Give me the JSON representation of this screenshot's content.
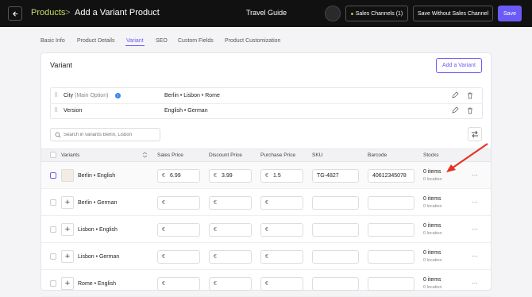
{
  "header": {
    "breadcrumb_root": "Products",
    "breadcrumb_sep": ">",
    "page_title": "Add a Variant Product",
    "store_name": "Travel Guide",
    "sales_channels_label": "Sales Channels (1)",
    "save_without_label": "Save Without Sales Channel",
    "save_label": "Save"
  },
  "tabs": [
    "Basic Info",
    "Product Details",
    "Variant",
    "SEO",
    "Custom Fields",
    "Product Customization"
  ],
  "variant_card": {
    "title": "Variant",
    "add_button": "Add a Variant",
    "options": [
      {
        "name": "City",
        "main": "(Main Option)",
        "values": "Berlin  •  Lisbon  •  Rome"
      },
      {
        "name": "Version",
        "main": "",
        "values": "English  •  German"
      }
    ],
    "search_placeholder": "Search in variants Berlin, Lisbon"
  },
  "table": {
    "columns": [
      "Variants",
      "Sales Price",
      "Discount Price",
      "Purchase Price",
      "SKU",
      "Barcode",
      "Stocks"
    ],
    "currency": "€",
    "rows": [
      {
        "name": "Berlin  •  English",
        "sales": "6.99",
        "discount": "3.99",
        "purchase": "1.5",
        "sku": "TG-4827",
        "barcode": "40612345078",
        "stock": "0 items",
        "location": "0 location"
      },
      {
        "name": "Berlin  •  German",
        "sales": "",
        "discount": "",
        "purchase": "",
        "sku": "",
        "barcode": "",
        "stock": "0 items",
        "location": "0 location"
      },
      {
        "name": "Lisbon  •  English",
        "sales": "",
        "discount": "",
        "purchase": "",
        "sku": "",
        "barcode": "",
        "stock": "0 items",
        "location": "0 location"
      },
      {
        "name": "Lisbon  •  German",
        "sales": "",
        "discount": "",
        "purchase": "",
        "sku": "",
        "barcode": "",
        "stock": "0 items",
        "location": "0 location"
      },
      {
        "name": "Rome  •  English",
        "sales": "",
        "discount": "",
        "purchase": "",
        "sku": "",
        "barcode": "",
        "stock": "0 items",
        "location": "0 location"
      }
    ],
    "more_label": "···"
  },
  "colors": {
    "accent": "#6b5bf6",
    "arrow": "#e53223",
    "topbar": "#111111"
  }
}
